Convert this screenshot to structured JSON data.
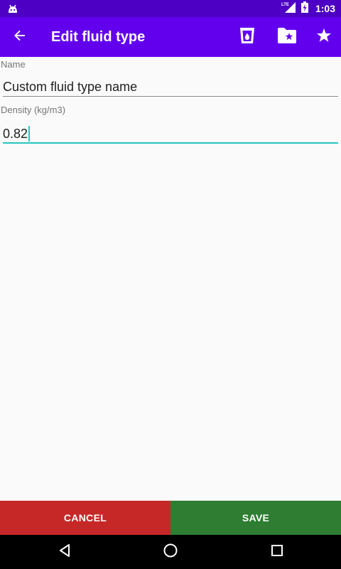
{
  "status_bar": {
    "time": "1:03",
    "network_badge": "LTE",
    "icons": [
      "android-icon",
      "signal-icon",
      "battery-charging-icon"
    ]
  },
  "app_bar": {
    "title": "Edit fluid type",
    "back_icon": "arrow-back-icon",
    "actions": [
      "fluid-glass-icon",
      "folder-star-icon",
      "star-icon"
    ],
    "color": "#6200ee",
    "status_color": "#4d00c4"
  },
  "form": {
    "name_label": "Name",
    "name_value": "Custom fluid type name",
    "density_label": "Density (kg/m3)",
    "density_value": "0.82",
    "accent_color": "#26c6bf"
  },
  "buttons": {
    "cancel_label": "CANCEL",
    "save_label": "SAVE",
    "cancel_color": "#c62828",
    "save_color": "#2e7d32"
  },
  "nav_bar": {
    "icons": [
      "nav-back-icon",
      "nav-home-icon",
      "nav-recents-icon"
    ]
  }
}
